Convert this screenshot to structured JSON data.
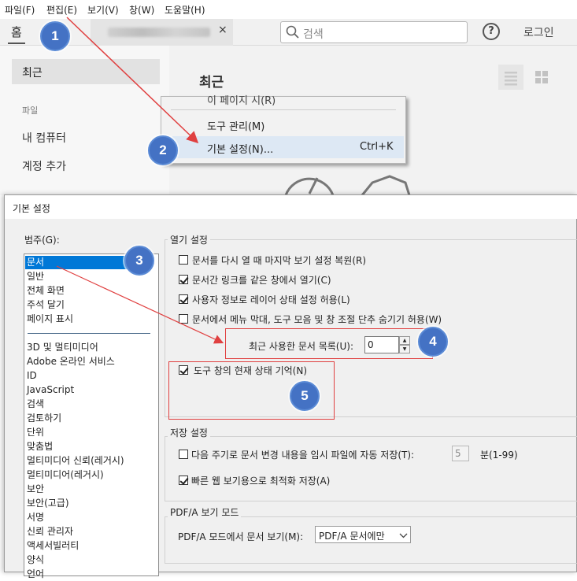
{
  "menubar": {
    "items": [
      "파일(F)",
      "편집(E)",
      "보기(V)",
      "창(W)",
      "도움말(H)"
    ]
  },
  "tabs": {
    "home": "홈",
    "doc_close": "×"
  },
  "search": {
    "placeholder": "검색"
  },
  "help_label": "?",
  "login": "로그인",
  "sidebar": {
    "recent": "최근",
    "section_label": "파일",
    "items": [
      "내 컴퓨터",
      "계정 추가"
    ]
  },
  "main": {
    "title": "최근"
  },
  "edit_menu": {
    "partial_item": "이 페이지 시(R)",
    "item_tools": "도구 관리(M)",
    "item_prefs": "기본 설정(N)...",
    "item_prefs_shortcut": "Ctrl+K"
  },
  "dialog": {
    "title": "기본 설정",
    "category_label": "범주(G):",
    "categories_top": [
      "문서",
      "일반",
      "전체 화면",
      "주석 달기",
      "페이지 표시"
    ],
    "categories_bottom": [
      "3D 및 멀티미디어",
      "Adobe 온라인 서비스",
      "ID",
      "JavaScript",
      "검색",
      "검토하기",
      "단위",
      "맞춤법",
      "멀티미디어 신뢰(레거시)",
      "멀티미디어(레거시)",
      "보안",
      "보안(고급)",
      "서명",
      "신뢰 관리자",
      "액세서빌러티",
      "양식",
      "언어"
    ],
    "open_settings": {
      "title": "열기 설정",
      "options": [
        {
          "label": "문서를 다시 열 때 마지막 보기 설정 복원(R)",
          "checked": false
        },
        {
          "label": "문서간 링크를 같은 창에서 열기(C)",
          "checked": true
        },
        {
          "label": "사용자 정보로 레이어 상태 설정 허용(L)",
          "checked": true
        },
        {
          "label": "문서에서 메뉴 막대, 도구 모음 및 창 조절 단추 숨기기 허용(W)",
          "checked": false
        }
      ],
      "recent_docs_label": "최근 사용한 문서 목록(U):",
      "recent_docs_value": "0",
      "tool_state_label": "도구 창의 현재 상태 기억(N)",
      "tool_state_checked": true
    },
    "save_settings": {
      "title": "저장 설정",
      "autosave_label": "다음 주기로 문서 변경 내용을 임시 파일에 자동 저장(T):",
      "autosave_checked": false,
      "interval_value": "5",
      "interval_unit": "분(1-99)",
      "fastweb_label": "빠른 웹 보기용으로 최적화 저장(A)",
      "fastweb_checked": true
    },
    "pdfa": {
      "title": "PDF/A 보기 모드",
      "label": "PDF/A 모드에서 문서 보기(M):",
      "value": "PDF/A 문서에만"
    }
  },
  "callouts": [
    "1",
    "2",
    "3",
    "4",
    "5"
  ],
  "colors": {
    "callout_blue": "#4472c4",
    "annotation_red": "#e04040",
    "selection_blue": "#0078d7"
  }
}
